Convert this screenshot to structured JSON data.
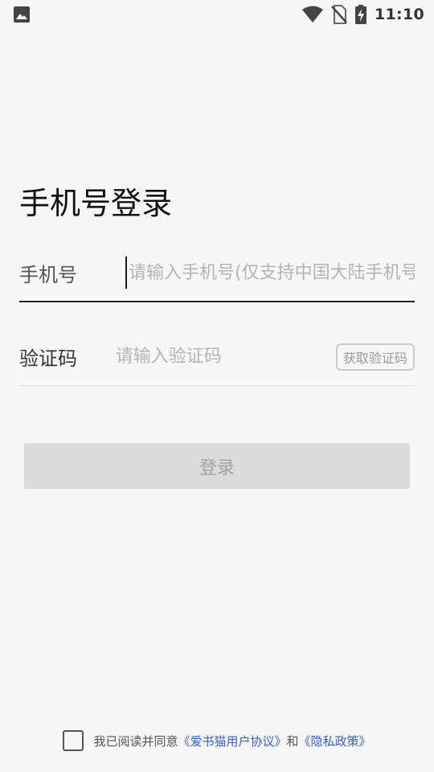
{
  "status_bar": {
    "time": "11:10",
    "icons": [
      "image-icon",
      "wifi-icon",
      "no-sim-icon",
      "battery-charging-icon"
    ]
  },
  "login": {
    "title": "手机号登录",
    "phone": {
      "label": "手机号",
      "placeholder": "请输入手机号(仅支持中国大陆手机号)"
    },
    "code": {
      "label": "验证码",
      "placeholder": "请输入验证码",
      "get_code_label": "获取验证码"
    },
    "submit_label": "登录"
  },
  "agreement": {
    "prefix": "我已阅读并同意",
    "user_agreement": "《爱书猫用户协议》",
    "and": "和",
    "privacy_policy": "《隐私政策》",
    "checked": false
  },
  "colors": {
    "background": "#f7f7f7",
    "link": "#3b62c8",
    "button_disabled": "#dadbdc"
  }
}
